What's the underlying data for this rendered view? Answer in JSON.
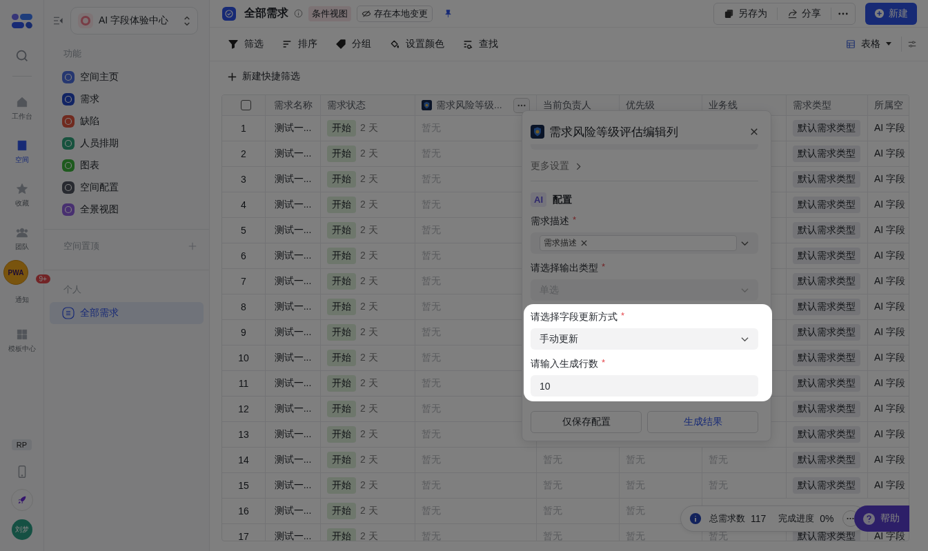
{
  "rail": {
    "items": [
      {
        "label": "工作台",
        "selected": false
      },
      {
        "label": "空间",
        "selected": true
      },
      {
        "label": "收藏",
        "selected": false
      },
      {
        "label": "团队",
        "selected": false
      },
      {
        "label": "通知",
        "selected": false,
        "badge": "9+"
      },
      {
        "label": "模板中心",
        "selected": false
      }
    ],
    "pwa_badge": "PWA",
    "env_chip": "RP",
    "avatar": "刘梦"
  },
  "sidebar": {
    "space_selector": "AI 字段体验中心",
    "feature_title": "功能",
    "features": [
      {
        "label": "空间主页",
        "selected": false
      },
      {
        "label": "需求",
        "selected": false
      },
      {
        "label": "缺陷",
        "selected": false
      },
      {
        "label": "人员排期",
        "selected": false
      },
      {
        "label": "图表",
        "selected": false
      },
      {
        "label": "空间配置",
        "selected": false
      },
      {
        "label": "全景视图",
        "selected": false
      }
    ],
    "pinned_title": "空间置顶",
    "personal_title": "个人",
    "personal": [
      {
        "label": "全部需求",
        "selected": true
      }
    ]
  },
  "header": {
    "title": "全部需求",
    "view_tag": "条件视图",
    "local_changes": "存在本地变更",
    "actions": [
      "另存为",
      "分享"
    ],
    "new_button": "新建"
  },
  "toolbar": {
    "items": [
      "筛选",
      "排序",
      "分组",
      "设置颜色",
      "查找"
    ],
    "view_switch": "表格",
    "quick_filter": "新建快捷筛选"
  },
  "table": {
    "select_all_checked": false,
    "columns": [
      "需求名称",
      "需求状态",
      "需求风险等级...",
      "当前负责人",
      "优先级",
      "业务线",
      "需求类型",
      "所属空"
    ],
    "rows": [
      {
        "index": "1",
        "name": "测试一...",
        "status": "开始",
        "duration": "2 天",
        "risk": "暂无",
        "type": "默认需求类型",
        "space": "AI 字段"
      },
      {
        "index": "2",
        "name": "测试一...",
        "status": "开始",
        "duration": "2 天",
        "risk": "暂无",
        "type": "默认需求类型",
        "space": "AI 字段"
      },
      {
        "index": "3",
        "name": "测试一...",
        "status": "开始",
        "duration": "2 天",
        "risk": "暂无",
        "type": "默认需求类型",
        "space": "AI 字段"
      },
      {
        "index": "4",
        "name": "测试一...",
        "status": "开始",
        "duration": "2 天",
        "risk": "暂无",
        "type": "默认需求类型",
        "space": "AI 字段"
      },
      {
        "index": "5",
        "name": "测试一...",
        "status": "开始",
        "duration": "2 天",
        "risk": "暂无",
        "type": "默认需求类型",
        "space": "AI 字段"
      },
      {
        "index": "6",
        "name": "测试一...",
        "status": "开始",
        "duration": "2 天",
        "risk": "暂无",
        "type": "默认需求类型",
        "space": "AI 字段"
      },
      {
        "index": "7",
        "name": "测试一...",
        "status": "开始",
        "duration": "2 天",
        "risk": "暂无",
        "type": "默认需求类型",
        "space": "AI 字段"
      },
      {
        "index": "8",
        "name": "测试一...",
        "status": "开始",
        "duration": "2 天",
        "risk": "暂无",
        "type": "默认需求类型",
        "space": "AI 字段"
      },
      {
        "index": "9",
        "name": "测试一...",
        "status": "开始",
        "duration": "2 天",
        "risk": "暂无",
        "type": "默认需求类型",
        "space": "AI 字段"
      },
      {
        "index": "10",
        "name": "测试一...",
        "status": "开始",
        "duration": "2 天",
        "risk": "暂无",
        "type": "默认需求类型",
        "space": "AI 字段"
      },
      {
        "index": "11",
        "name": "测试一...",
        "status": "开始",
        "duration": "2 天",
        "risk": "暂无",
        "type": "默认需求类型",
        "space": "AI 字段"
      },
      {
        "index": "12",
        "name": "测试一...",
        "status": "开始",
        "duration": "2 天",
        "risk": "暂无",
        "type": "默认需求类型",
        "space": "AI 字段"
      },
      {
        "index": "13",
        "name": "测试一...",
        "status": "开始",
        "duration": "2 天",
        "risk": "暂无",
        "type": "默认需求类型",
        "space": "AI 字段"
      },
      {
        "index": "14",
        "name": "测试一...",
        "status": "开始",
        "duration": "2 天",
        "risk": "暂无",
        "owner": "暂无",
        "priority": "暂无",
        "business_line": "暂无",
        "type": "默认需求类型",
        "space": "AI 字段"
      },
      {
        "index": "15",
        "name": "测试一...",
        "status": "开始",
        "duration": "2 天",
        "risk": "暂无",
        "owner": "暂无",
        "priority": "暂无",
        "business_line": "暂无",
        "type": "默认需求类型",
        "space": "AI 字段"
      },
      {
        "index": "16",
        "name": "测试一...",
        "status": "开始",
        "duration": "2 天",
        "risk": "暂无",
        "owner": "暂无",
        "priority": "暂无"
      },
      {
        "index": "17",
        "name": "测试一...",
        "status": "开始",
        "duration": "2 天",
        "risk": "暂无",
        "owner": "暂无",
        "priority": "暂无",
        "business_line": "暂无",
        "type": "默认需求类型",
        "space": "AI 字段"
      }
    ]
  },
  "popup": {
    "title": "需求风险等级评估编辑列",
    "more_settings": "更多设置",
    "ai_badge": "AI",
    "section": "配置",
    "fields": [
      {
        "label": "需求描述",
        "required_mark": "*",
        "kind": "tags",
        "tags": [
          "需求描述"
        ]
      },
      {
        "label": "请选择输出类型",
        "required_mark": "*",
        "kind": "select",
        "placeholder": "单选"
      }
    ],
    "spotlight_fields": [
      {
        "label": "请选择字段更新方式",
        "required_mark": "*",
        "kind": "select",
        "value": "手动更新"
      },
      {
        "label": "请输入生成行数",
        "required_mark": "*",
        "kind": "input",
        "value": "10"
      }
    ],
    "buttons": [
      "仅保存配置",
      "生成结果"
    ]
  },
  "stats": {
    "total_label": "总需求数",
    "total": "117",
    "progress_label": "完成进度",
    "progress": "0%"
  },
  "help": "帮助"
}
